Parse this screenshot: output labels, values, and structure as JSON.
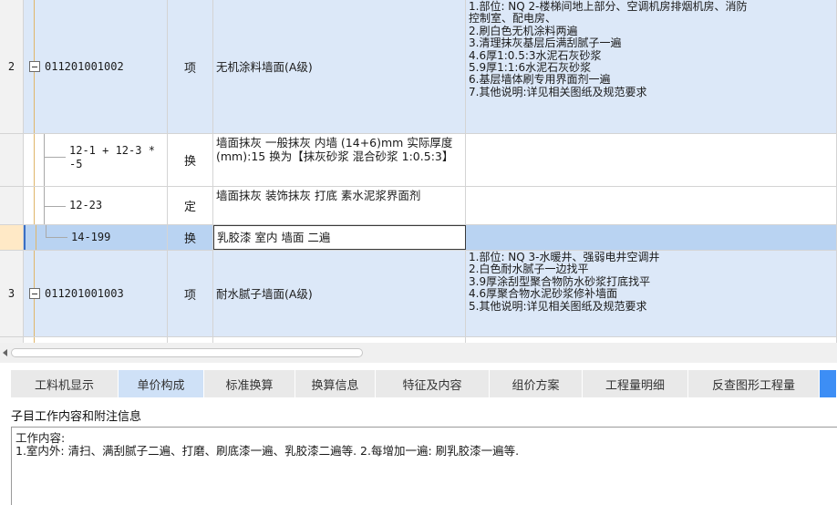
{
  "rows": [
    {
      "num": "2",
      "code": "011201001002",
      "unit": "项",
      "name": "无机涂料墙面(A级)",
      "features": [
        "1.部位: NQ 2-楼梯间地上部分、空调机房排烟机房、消防",
        "控制室、配电房、",
        "2.刷白色无机涂料两遍",
        "3.清理抹灰基层后满刮腻子一遍",
        "4.6厚1:0.5:3水泥石灰砂浆",
        "5.9厚1:1:6水泥石灰砂浆",
        "6.基层墙体刷专用界面剂一遍",
        "7.其他说明:详见相关图纸及规范要求"
      ]
    },
    {
      "code": "12-1 + 12-3 *",
      "code2": "-5",
      "unit": "换",
      "name": "墙面抹灰 一般抹灰 内墙 (14+6)mm 实际厚度(mm):15  换为【抹灰砂浆 混合砂浆 1:0.5:3】"
    },
    {
      "code": "12-23",
      "unit": "定",
      "name": "墙面抹灰 装饰抹灰 打底 素水泥浆界面剂"
    },
    {
      "code": "14-199",
      "unit": "换",
      "name": "乳胶漆 室内 墙面 二遍"
    },
    {
      "num": "3",
      "code": "011201001003",
      "unit": "项",
      "name": "耐水腻子墙面(A级)",
      "features": [
        "1.部位: NQ 3-水暖井、强弱电井空调井",
        "2.白色耐水腻子一边找平",
        "3.9厚涂刮型聚合物防水砂浆打底找平",
        "4.6厚聚合物水泥砂浆修补墙面",
        "5.其他说明:详见相关图纸及规范要求"
      ]
    }
  ],
  "tabs": [
    "工料机显示",
    "单价构成",
    "标准换算",
    "换算信息",
    "特征及内容",
    "组价方案",
    "工程量明细",
    "反查图形工程量"
  ],
  "active_tab_index": 1,
  "panel": {
    "title": "子目工作内容和附注信息",
    "content_label": "工作内容:",
    "content_text": "1.室内外: 清扫、满刮腻子二遍、打磨、刷底漆一遍、乳胶漆二遍等. 2.每增加一遍: 刷乳胶漆一遍等."
  },
  "colors": {
    "row_blue": "#dce8f8",
    "row_selected": "#b9d3f2",
    "tab_active": "#cfe1f7",
    "accent": "#3d8ef5"
  }
}
